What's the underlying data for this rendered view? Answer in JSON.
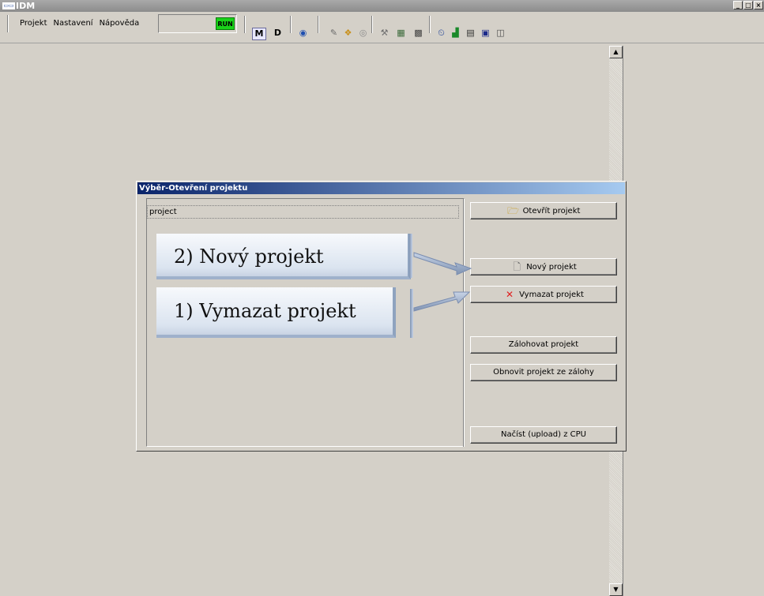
{
  "window": {
    "logo": "IDM",
    "title": "IDM"
  },
  "menubar": {
    "items": [
      "Projekt",
      "Nastavení",
      "Nápověda"
    ],
    "run_label": "RUN",
    "m_label": "M",
    "d_label": "D"
  },
  "dialog": {
    "title": "Výběr-Otevření projektu",
    "project_value": "project",
    "buttons": {
      "open": "Otevřít projekt",
      "new": "Nový projekt",
      "delete": "Vymazat projekt",
      "backup": "Zálohovat projekt",
      "restore": "Obnovit projekt ze zálohy",
      "upload": "Načíst (upload) z CPU"
    }
  },
  "annotations": {
    "new": "2) Nový projekt",
    "delete": "1) Vymazat projekt"
  },
  "colors": {
    "run": "#19d219",
    "dialog_title_start": "#0a246a",
    "dialog_title_end": "#a6caf0",
    "delete_icon": "#e02020"
  }
}
